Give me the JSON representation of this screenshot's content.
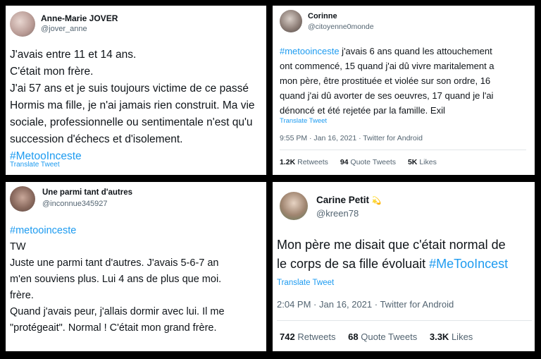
{
  "tweets": [
    {
      "name": "Anne-Marie JOVER",
      "handle": "@jover_anne",
      "lines": [
        "J'avais entre 11 et 14 ans.",
        "C'était mon frère.",
        "J'ai 57 ans et je suis toujours victime de ce passé",
        "Hormis ma fille, je n'ai jamais rien construit. Ma vie",
        "sociale, professionnelle ou sentimentale n'est qu'u",
        "succession d'échecs  et d'isolement."
      ],
      "hashtag": "#MetooInceste",
      "translate": "Translate Tweet"
    },
    {
      "name": "Corinne",
      "handle": "@citoyenne0monde",
      "hashtag": "#metooinceste",
      "lines": [
        " j'avais 6 ans quand les attouchement",
        "ont commencé, 15 quand j'ai dû vivre maritalement a",
        "mon père, être prostituée et violée sur son ordre, 16",
        "quand j'ai dû avorter de ses oeuvres, 17 quand je l'ai",
        "dénoncé et été rejetée par la famille. Exil"
      ],
      "translate": "Translate Tweet",
      "meta": "9:55 PM · Jan 16, 2021 · Twitter for Android",
      "stats": {
        "retweets_value": "1.2K",
        "retweets_label": "Retweets",
        "quotes_value": "94",
        "quotes_label": "Quote Tweets",
        "likes_value": "5K",
        "likes_label": "Likes"
      }
    },
    {
      "name": "Une parmi tant d'autres",
      "handle": "@inconnue345927",
      "hashtag": "#metooinceste",
      "lines": [
        "TW",
        "Juste une parmi tant d'autres. J'avais 5-6-7 an",
        "m'en souviens plus. Lui 4 ans de plus que moi.",
        "frère.",
        "Quand j'avais peur, j'allais dormir avec lui. Il me",
        "\"protégeait\". Normal ! C'était mon grand frère."
      ]
    },
    {
      "name": "Carine Petit",
      "name_emoji": "💫",
      "handle": "@kreen78",
      "lines": [
        "Mon père me disait que c'était normal de",
        "le corps de sa fille évoluait "
      ],
      "hashtag": "#MeTooIncest",
      "translate": "Translate Tweet",
      "meta": "2:04 PM · Jan 16, 2021 · Twitter for Android",
      "stats": {
        "retweets_value": "742",
        "retweets_label": "Retweets",
        "quotes_value": "68",
        "quotes_label": "Quote Tweets",
        "likes_value": "3.3K",
        "likes_label": "Likes"
      }
    }
  ],
  "colors": {
    "link": "#1d9bf0",
    "text": "#0f1419",
    "muted": "#536471",
    "background": "#000000"
  }
}
